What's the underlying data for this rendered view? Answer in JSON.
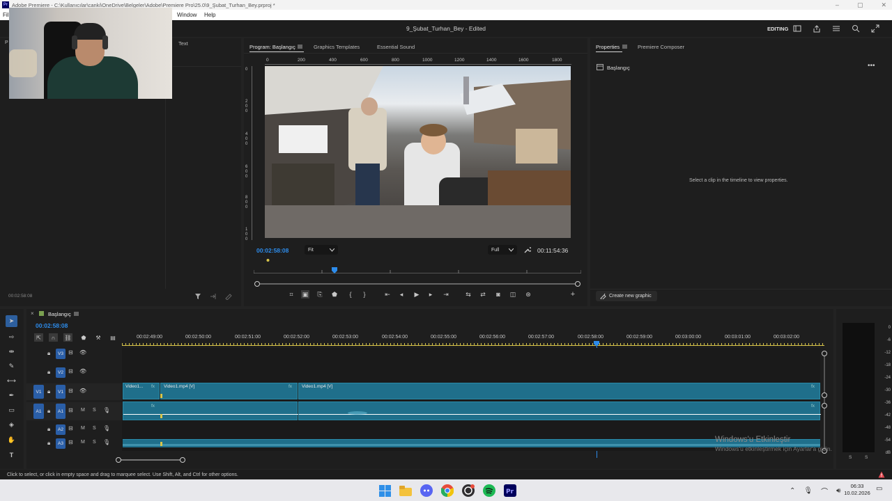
{
  "window": {
    "title": "Adobe Premiere - C:\\Kullanıcılar\\canki\\OneDrive\\Belgeler\\Adobe\\Premiere Pro\\25.0\\9_Şubat_Turhan_Bey.prproj *"
  },
  "menu": {
    "items": [
      "Fil",
      "Window",
      "Help"
    ]
  },
  "header": {
    "project_title": "9_Şubat_Turhan_Bey",
    "status": "Edited",
    "workspace": "EDITING"
  },
  "source_panel": {
    "tab_text": "Text",
    "timecode": "00:02:58:08"
  },
  "program": {
    "tabs": [
      "Program: Başlangıç",
      "Graphics Templates",
      "Essential Sound"
    ],
    "ruler_ticks": [
      "0",
      "200",
      "400",
      "600",
      "800",
      "1000",
      "1200",
      "1400",
      "1600",
      "1800"
    ],
    "vruler_ticks": [
      "0",
      "2\n0\n0",
      "4\n0\n0",
      "6\n0\n0",
      "8\n0\n0",
      "1\n0\n0"
    ],
    "current_timecode": "00:02:58:08",
    "fit_option": "Fit",
    "quality_option": "Full",
    "duration": "00:11:54:36",
    "playhead_fraction": 0.25
  },
  "properties": {
    "tabs": [
      "Properties",
      "Premiere Composer"
    ],
    "sequence_name": "Başlangıç",
    "empty_message": "Select a clip in the timeline to view properties.",
    "create_button": "Create new graphic"
  },
  "timeline": {
    "sequence_tab": "Başlangıç",
    "timecode": "00:02:58:08",
    "ruler_labels": [
      "00:02:49:00",
      "00:02:50:00",
      "00:02:51:00",
      "00:02:52:00",
      "00:02:53:00",
      "00:02:54:00",
      "00:02:55:00",
      "00:02:56:00",
      "00:02:57:00",
      "00:02:58:00",
      "00:02:59:00",
      "00:03:00:00",
      "00:03:01:00",
      "00:03:02:00"
    ],
    "tracks": {
      "video": [
        {
          "source": "",
          "label": "V3"
        },
        {
          "source": "",
          "label": "V2"
        },
        {
          "source": "V1",
          "label": "V1"
        }
      ],
      "audio": [
        {
          "source": "A1",
          "label": "A1",
          "m": "M",
          "s": "S"
        },
        {
          "source": "",
          "label": "A2",
          "m": "M",
          "s": "S"
        },
        {
          "source": "",
          "label": "A3",
          "m": "M",
          "s": "S"
        }
      ]
    },
    "clips": [
      {
        "name": "Video1...",
        "fx": "fx"
      },
      {
        "name": "Video1.mp4 [V]",
        "fx": "fx"
      },
      {
        "name": "Video1.mp4 [V]",
        "fx": "fx"
      }
    ],
    "audio_fx": "fx"
  },
  "meter": {
    "labels": [
      "0",
      "-6",
      "-12",
      "-18",
      "-24",
      "-30",
      "-36",
      "-42",
      "-48",
      "-54",
      "dB"
    ],
    "bottom": [
      "S",
      "S"
    ]
  },
  "watermark": {
    "title": "Windows'u Etkinleştir",
    "subtitle": "Windows'u etkinleştirmek için Ayarlar'a gidin."
  },
  "statusbar": {
    "text": "Click to select, or click in empty space and drag to marquee select. Use Shift, Alt, and Ctrl for other options."
  },
  "taskbar": {
    "time": "06:33",
    "date": "10.02.2026"
  },
  "colors": {
    "accent": "#2d8ceb",
    "clip": "#1f6f8b",
    "clip_header": "#2a8aa8",
    "blue_tag": "#2a5ea7",
    "yellow": "#d8c54a"
  }
}
